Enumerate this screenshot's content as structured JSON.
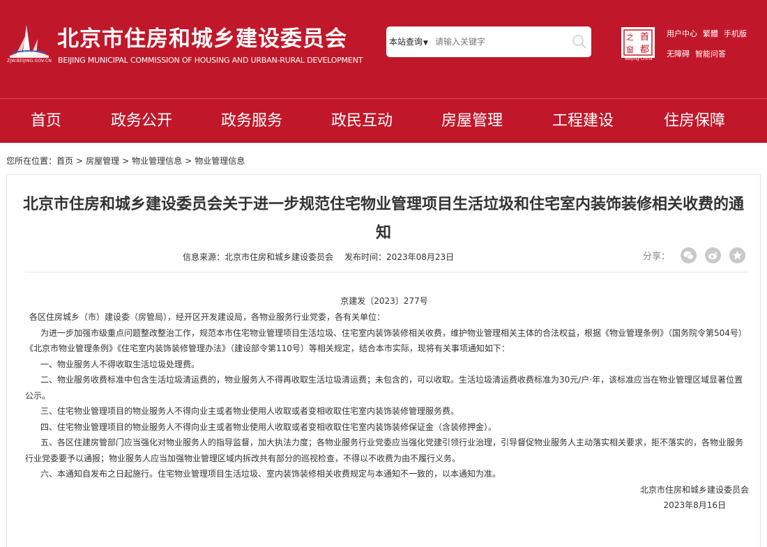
{
  "header": {
    "logo_domain": "ZJW.BEIJING.GOV.CN",
    "title": "北京市住房和城乡建设委员会",
    "title_en": "BEIJING MUNICIPAL COMMISSION OF HOUSING AND URBAN-RURAL DEVELOPMENT",
    "search": {
      "scope": "本站查询",
      "placeholder": "请输入关键字"
    },
    "seal": {
      "chars": [
        "首",
        "都",
        "之",
        "窗"
      ],
      "caption": "Beijing·China"
    },
    "links_row1": [
      "用户中心",
      "繁體",
      "手机版"
    ],
    "links_row2": [
      "无障碍",
      "智能问答"
    ]
  },
  "nav": [
    "首页",
    "政务公开",
    "政务服务",
    "政民互动",
    "房屋管理",
    "工程建设",
    "住房保障"
  ],
  "breadcrumb": {
    "prefix": "您所在位置：",
    "items": [
      "首页",
      "房屋管理",
      "物业管理信息",
      "物业管理信息"
    ],
    "separator": ">"
  },
  "article": {
    "title": "北京市住房和城乡建设委员会关于进一步规范住宅物业管理项目生活垃圾和住宅室内装饰装修相关收费的通知",
    "source_label": "信息来源：",
    "source": "北京市住房和城乡建设委员会",
    "date_label": "发布时间：",
    "date": "2023年08月23日",
    "share_label": "分享：",
    "share_icons": [
      "wechat-icon",
      "weibo-icon",
      "favorite-icon"
    ],
    "doc_no": "京建发〔2023〕277号",
    "salutation": "各区住房城乡（市）建设委（房管局），经开区开发建设局，各物业服务行业党委，各有关单位：",
    "paragraphs": [
      "为进一步加强市级重点问题整改整治工作，规范本市住宅物业管理项目生活垃圾、住宅室内装饰装修相关收费，维护物业管理相关主体的合法权益，根据《物业管理条例》（国务院令第504号）《北京市物业管理条例》《住宅室内装饰装修管理办法》（建设部令第110号）等相关规定，结合本市实际，现将有关事项通知如下：",
      "一、物业服务人不得收取生活垃圾处理费。",
      "二、物业服务收费标准中包含生活垃圾清运费的，物业服务人不得再收取生活垃圾清运费；未包含的，可以收取。生活垃圾清运费收费标准为30元/户·年，该标准应当在物业管理区域显著位置公示。",
      "三、住宅物业管理项目的物业服务人不得向业主或者物业使用人收取或者变相收取住宅室内装饰装修管理服务费。",
      "四、住宅物业管理项目的物业服务人不得向业主或者物业使用人收取或者变相收取住宅室内装饰装修保证金（含装修押金）。",
      "五、各区住建房管部门应当强化对物业服务人的指导监督，加大执法力度；各物业服务行业党委应当强化党建引领行业治理，引导督促物业服务人主动落实相关要求，拒不落实的，各物业服务行业党委要予以通报；物业服务人应当加强物业管理区域内拆改共有部分的巡视检查，不得以不收费为由不履行义务。",
      "六、本通知自发布之日起施行。住宅物业管理项目生活垃圾、室内装饰装修相关收费规定与本通知不一致的，以本通知为准。"
    ],
    "signature": "北京市住房和城乡建设委员会",
    "sign_date": "2023年8月16日"
  }
}
